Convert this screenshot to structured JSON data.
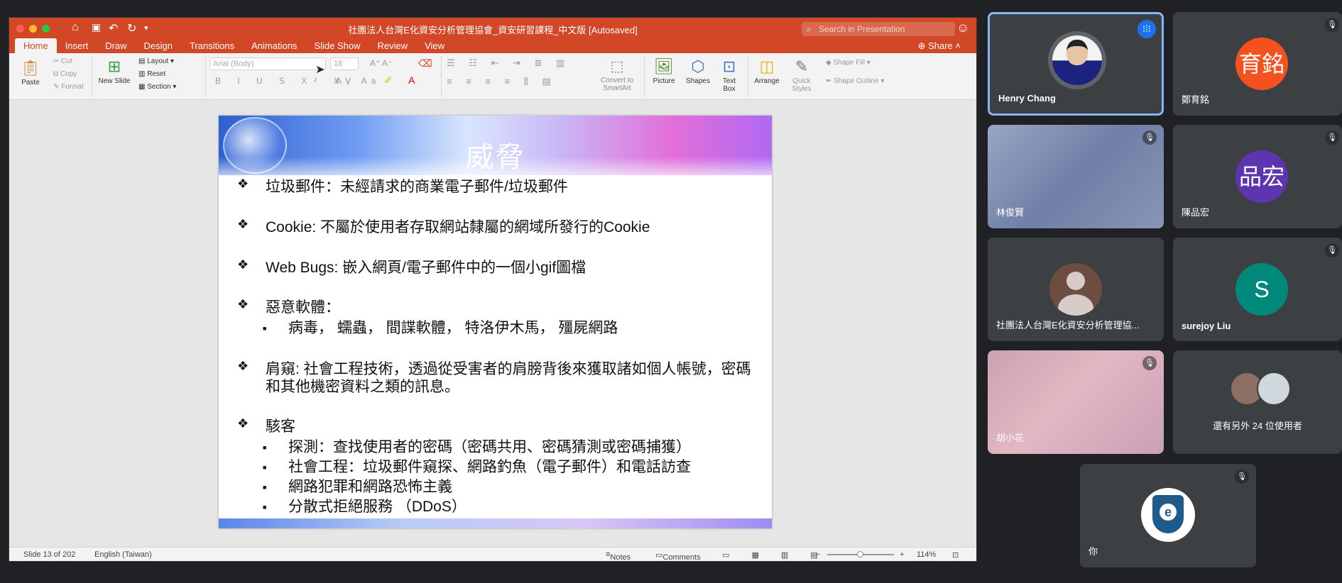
{
  "window": {
    "title": "社團法人台灣E化資安分析管理協會_資安研習課程_中文版 [Autosaved]",
    "search_placeholder": "Search in Presentation",
    "share_label": "Share"
  },
  "tabs": [
    "Home",
    "Insert",
    "Draw",
    "Design",
    "Transitions",
    "Animations",
    "Slide Show",
    "Review",
    "View"
  ],
  "ribbon": {
    "paste": "Paste",
    "cut": "Cut",
    "copy": "Copy",
    "format": "Format",
    "new_slide": "New Slide",
    "layout": "Layout",
    "reset": "Reset",
    "section": "Section",
    "font_name": "Arial (Body)",
    "font_size": "18",
    "convert_smartart": "Convert to SmartArt",
    "picture": "Picture",
    "shapes": "Shapes",
    "text_box": "Text Box",
    "arrange": "Arrange",
    "quick_styles": "Quick Styles",
    "shape_fill": "Shape Fill",
    "shape_outline": "Shape Outline"
  },
  "slide": {
    "title": "威脅",
    "b1": "垃圾郵件：未經請求的商業電子郵件/垃圾郵件",
    "b2": "Cookie: 不屬於使用者存取網站隸屬的網域所發行的Cookie",
    "b3": "Web Bugs: 嵌入網頁/電子郵件中的一個小gif圖檔",
    "b4": "惡意軟體：",
    "b4s1": "病毒， 蠕蟲， 間諜軟體， 特洛伊木馬， 殭屍網路",
    "b5_line1": "肩窺: 社會工程技術，透過從受害者的肩膀背後來獲取諸如個人帳號，密碼",
    "b5_line2": "和其他機密資料之類的訊息。",
    "b6": "駭客",
    "b6s1": "探測：查找使用者的密碼（密碼共用、密碼猜測或密碼捕獲）",
    "b6s2": "社會工程：垃圾郵件窺探、網路釣魚（電子郵件）和電話訪查",
    "b6s3": "網路犯罪和網路恐怖主義",
    "b6s4": "分散式拒絕服務 （DDoS）"
  },
  "status": {
    "slide_num": "Slide 13 of 202",
    "language": "English (Taiwan)",
    "notes": "Notes",
    "comments": "Comments",
    "zoom": "114%"
  },
  "participants": {
    "p1": "Henry Chang",
    "p2": "鄭育銘",
    "p2_initials": "育銘",
    "p3": "林俊賢",
    "p4": "陳品宏",
    "p4_initials": "品宏",
    "p5": "社團法人台灣E化資安分析管理協...",
    "p6": "surejoy Liu",
    "p6_initials": "S",
    "p7": "胡小花",
    "others": "還有另外 24 位使用者",
    "self": "你"
  },
  "colors": {
    "ppt_accent": "#d24726",
    "active_speaker": "#8ab4f8",
    "avatar_p2": "#f4511e",
    "avatar_p4": "#5e35b1",
    "avatar_p6": "#00897b"
  }
}
